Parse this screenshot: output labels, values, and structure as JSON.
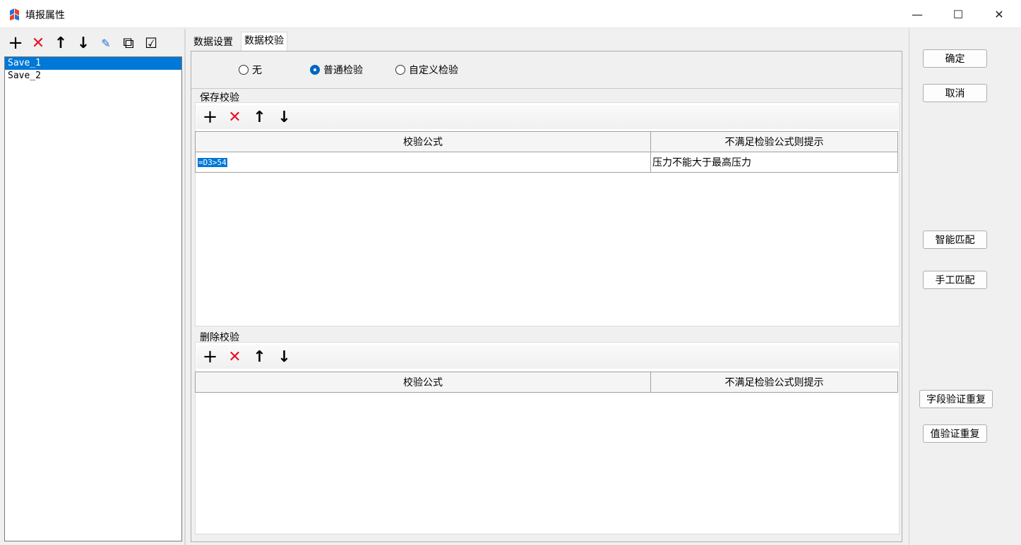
{
  "window": {
    "title": "填报属性",
    "minimize": "—",
    "maximize": "☐",
    "close": "✕"
  },
  "left_toolbar": {
    "add": "+",
    "delete": "✕",
    "up": "↑",
    "down": "↓",
    "edit": "✎",
    "copy": "⧉",
    "check": "☑"
  },
  "save_list": {
    "items": [
      "Save_1",
      "Save_2"
    ],
    "selected_index": 0
  },
  "tabs": [
    "数据设置",
    "数据校验"
  ],
  "active_tab": 1,
  "validation_mode": {
    "options": [
      "无",
      "普通检验",
      "自定义检验"
    ],
    "selected": "普通检验"
  },
  "save_check": {
    "title": "保存校验",
    "toolbar": {
      "add": "+",
      "delete": "✕",
      "up": "↑",
      "down": "↓"
    },
    "columns": [
      "校验公式",
      "不满足检验公式则提示"
    ],
    "rows": [
      {
        "formula": "=D3>54",
        "message": "压力不能大于最高压力"
      }
    ]
  },
  "delete_check": {
    "title": "删除校验",
    "toolbar": {
      "add": "+",
      "delete": "✕",
      "up": "↑",
      "down": "↓"
    },
    "columns": [
      "校验公式",
      "不满足检验公式则提示"
    ],
    "rows": []
  },
  "right_buttons": {
    "ok": "确定",
    "cancel": "取消",
    "smart_match": "智能匹配",
    "manual_match": "手工匹配",
    "field_repeat": "字段验证重复",
    "value_repeat": "值验证重复"
  },
  "colors": {
    "selection": "#0078d7",
    "delete_icon": "#e81123",
    "radio_checked": "#0067c0"
  }
}
